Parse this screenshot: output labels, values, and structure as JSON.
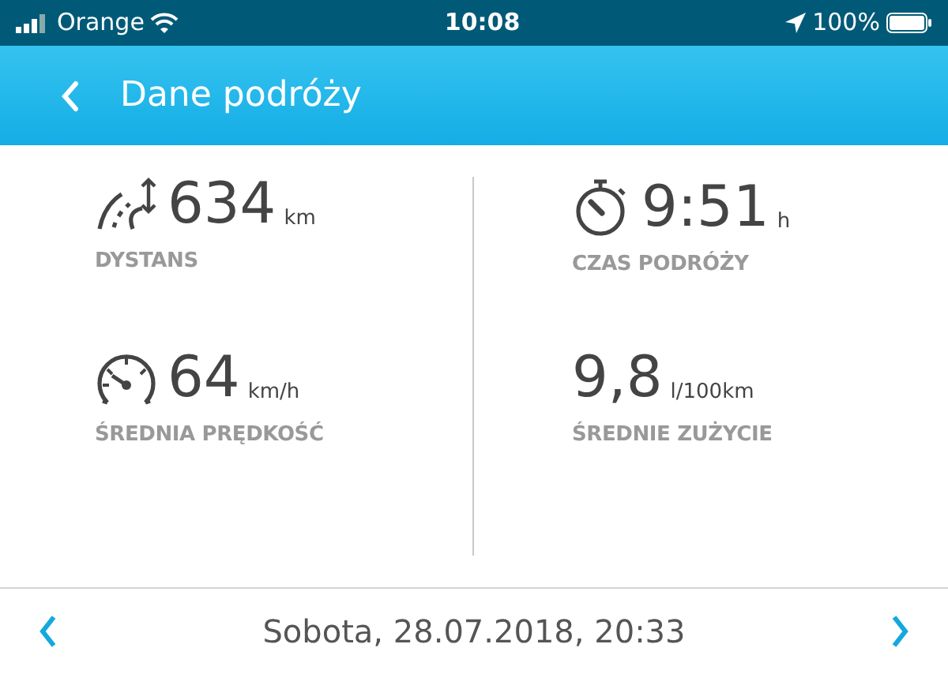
{
  "status_bar": {
    "carrier": "Orange",
    "time": "10:08",
    "battery": "100%"
  },
  "header": {
    "title": "Dane podróży"
  },
  "columns": [
    [
      {
        "kind": "distance",
        "value": "634",
        "unit": "km",
        "label": "DYSTANS"
      },
      {
        "kind": "speed",
        "value": "64",
        "unit": "km/h",
        "label": "ŚREDNIA PRĘDKOŚĆ"
      }
    ],
    [
      {
        "kind": "time",
        "value": "9:51",
        "unit": "h",
        "label": "CZAS PODRÓŻY"
      },
      {
        "kind": "plain",
        "value": "9,8",
        "unit": "l/100km",
        "label": "ŚREDNIE ZUŻYCIE"
      }
    ]
  ],
  "footer": {
    "date": "Sobota, 28.07.2018, 20:33"
  }
}
